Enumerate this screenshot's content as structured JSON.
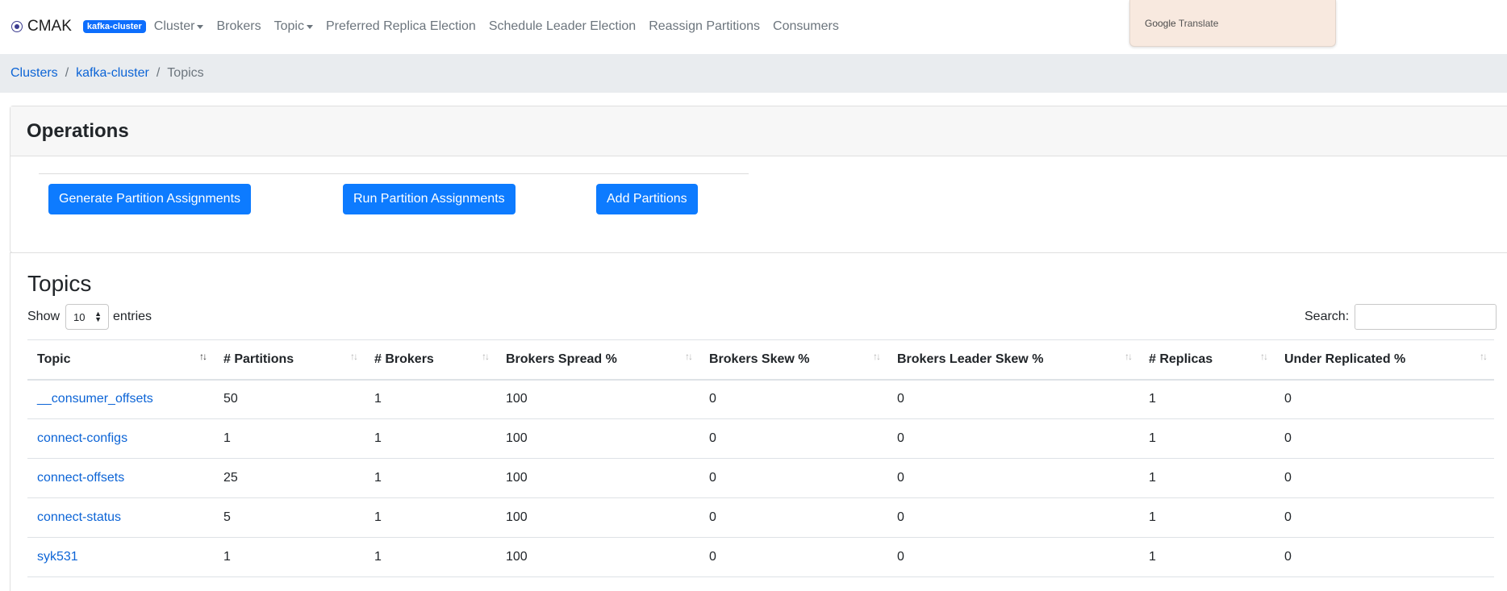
{
  "navbar": {
    "brand": "CMAK",
    "cluster_badge": "kafka-cluster",
    "items": [
      {
        "label": "Cluster",
        "dropdown": true
      },
      {
        "label": "Brokers",
        "dropdown": false
      },
      {
        "label": "Topic",
        "dropdown": true
      },
      {
        "label": "Preferred Replica Election",
        "dropdown": false
      },
      {
        "label": "Schedule Leader Election",
        "dropdown": false
      },
      {
        "label": "Reassign Partitions",
        "dropdown": false
      },
      {
        "label": "Consumers",
        "dropdown": false
      }
    ]
  },
  "translate_widget": {
    "google": "Google",
    "label": "Translate"
  },
  "breadcrumb": {
    "clusters": "Clusters",
    "cluster": "kafka-cluster",
    "current": "Topics",
    "separator": "/"
  },
  "operations": {
    "title": "Operations",
    "buttons": {
      "generate": "Generate Partition Assignments",
      "run": "Run Partition Assignments",
      "add": "Add Partitions"
    }
  },
  "topics": {
    "title": "Topics",
    "show_label": "Show",
    "entries_value": "10",
    "entries_label": "entries",
    "search_label": "Search:",
    "search_value": "",
    "columns": [
      "Topic",
      "# Partitions",
      "# Brokers",
      "Brokers Spread %",
      "Brokers Skew %",
      "Brokers Leader Skew %",
      "# Replicas",
      "Under Replicated %"
    ],
    "rows": [
      [
        "__consumer_offsets",
        "50",
        "1",
        "100",
        "0",
        "0",
        "1",
        "0"
      ],
      [
        "connect-configs",
        "1",
        "1",
        "100",
        "0",
        "0",
        "1",
        "0"
      ],
      [
        "connect-offsets",
        "25",
        "1",
        "100",
        "0",
        "0",
        "1",
        "0"
      ],
      [
        "connect-status",
        "5",
        "1",
        "100",
        "0",
        "0",
        "1",
        "0"
      ],
      [
        "syk531",
        "1",
        "1",
        "100",
        "0",
        "0",
        "1",
        "0"
      ]
    ]
  }
}
